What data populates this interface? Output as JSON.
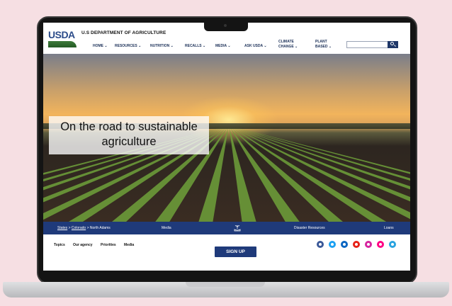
{
  "header": {
    "logo_text": "USDA",
    "dept_name": "U.S DEPARTMENT OF AGRICULTURE",
    "nav": [
      {
        "label": "HOME"
      },
      {
        "label": "RESOURCES"
      },
      {
        "label": "NUTRITION"
      },
      {
        "label": "RECALLS"
      },
      {
        "label": "MEDIA"
      },
      {
        "label": "ASK USDA"
      },
      {
        "label": "CLIMATE CHANGE"
      },
      {
        "label": "PLANT BASED"
      }
    ],
    "search_placeholder": ""
  },
  "hero": {
    "caption": "On the road to sustainable agriculture"
  },
  "bluebar": {
    "breadcrumb": [
      "States",
      "Colorado",
      "North Adams"
    ],
    "separator": ">",
    "media": "Media",
    "disaster": "Disaster Resources",
    "loans": "Loans"
  },
  "footer": {
    "links": [
      "Topics",
      "Our agency",
      "Priorities",
      "Media"
    ],
    "signup": "SIGN UP",
    "social": [
      {
        "icon": "facebook-icon",
        "color": "#3b5998"
      },
      {
        "icon": "twitter-icon",
        "color": "#1da1f2"
      },
      {
        "icon": "linkedin-icon",
        "color": "#0a66c2"
      },
      {
        "icon": "youtube-icon",
        "color": "#e62117"
      },
      {
        "icon": "instagram-icon",
        "color": "#d6249f"
      },
      {
        "icon": "flickr-icon",
        "color": "#ff0084"
      },
      {
        "icon": "telegram-icon",
        "color": "#2aa3df"
      }
    ]
  }
}
